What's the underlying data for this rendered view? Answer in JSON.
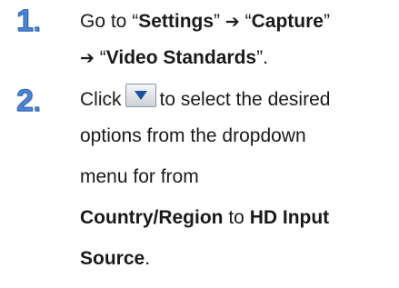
{
  "steps": [
    {
      "number": "1",
      "dot": ".",
      "line1": {
        "prefix": "Go to “",
        "settings": "Settings",
        "mid1": "” ",
        "arrow1": "➔",
        "mid2": " “",
        "capture": "Capture",
        "suffix": "”"
      },
      "line2": {
        "arrow": "➔",
        "prefix": " “",
        "video_standards": "Video Standards",
        "suffix": "”."
      }
    },
    {
      "number": "2",
      "dot": ".",
      "line1": {
        "prefix": "Click",
        "icon": "dropdown-arrow-icon",
        "suffix": "to select the desired"
      },
      "line2": "options from the dropdown",
      "line3": "menu for from",
      "line4": {
        "country_region": "Country/Region",
        "mid": " to ",
        "hd_input": "HD Input"
      },
      "line5": {
        "source": "Source",
        "suffix": "."
      }
    }
  ]
}
